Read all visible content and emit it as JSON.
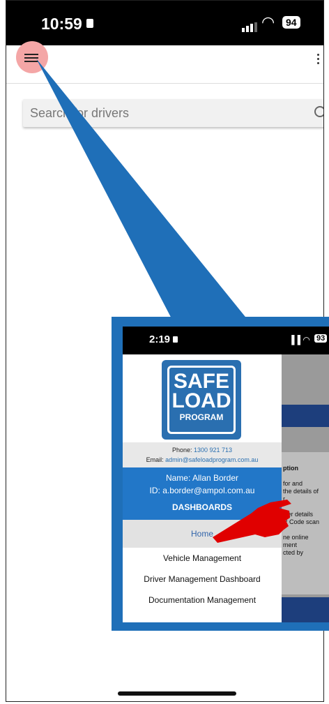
{
  "status": {
    "time": "10:59",
    "battery": "94"
  },
  "search": {
    "placeholder": "Search for drivers"
  },
  "inset": {
    "status": {
      "time": "2:19",
      "battery": "93"
    },
    "logo": {
      "line1": "SAFE",
      "line2": "LOAD",
      "line3": "PROGRAM"
    },
    "contact": {
      "phone_label": "Phone:",
      "phone": "1300 921 713",
      "email_label": "Email:",
      "email": "admin@safeloadprogram.com.au"
    },
    "user": {
      "name": "Name: Allan Border",
      "id": "ID: a.border@ampol.com.au",
      "section": "DASHBOARDS"
    },
    "menu": [
      "Home",
      "Vehicle Management",
      "Driver Management Dashboard",
      "Documentation Management"
    ],
    "behind_text": [
      "ption",
      "for and",
      "the details of",
      "r",
      "iver details",
      "R Code scan",
      "ne online",
      "ment",
      "cted by"
    ]
  },
  "colors": {
    "accent": "#2277c8",
    "highlight": "#f4a6a6",
    "pointer": "#1f6fb8",
    "hand": "#e00000"
  }
}
